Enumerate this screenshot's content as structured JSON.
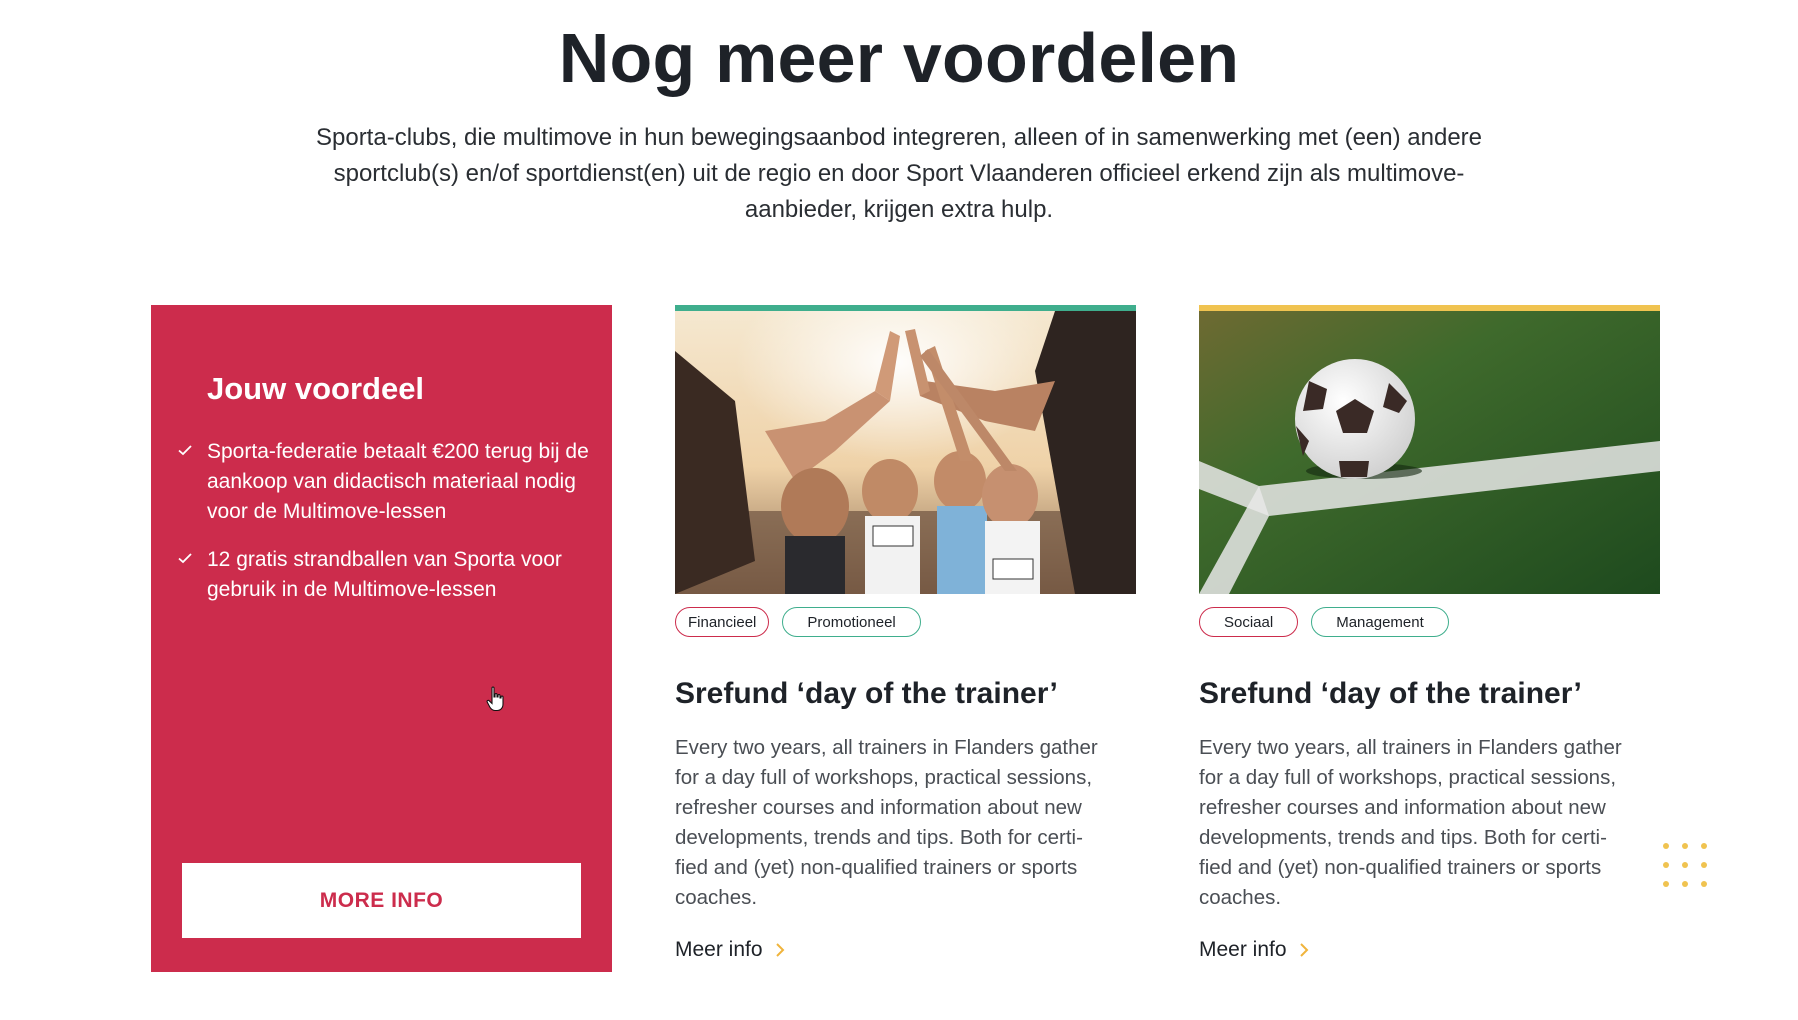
{
  "header": {
    "title": "Nog meer voordelen",
    "intro": "Sporta-clubs, die multimove in hun bewegingsaanbod integreren, alleen of in samenwerking met (een) andere sportclub(s) en/of sportdienst(en) uit de regio en door Sport Vlaanderen officieel erkend zijn als multimove-aanbieder, krijgen extra hulp."
  },
  "promo": {
    "title": "Jouw voordeel",
    "items": [
      "Sporta-federatie betaalt €200 terug bij de aankoop van didactisch materiaal nodig voor de Multimove-lessen",
      "12 gratis strandballen van Sporta voor gebruik in de Multimove-lessen"
    ],
    "button_label": "MORE INFO",
    "background_color": "#cc2c4c"
  },
  "cards": [
    {
      "accent_color": "#3fae8d",
      "image": "athletes-high-five-photo",
      "tags": [
        "Financieel",
        "Promotioneel"
      ],
      "title": "Srefund ‘day of the trainer’",
      "description": "Every two years, all trainers in Flanders gather for a day full of workshops, practical sessions, refresher courses and information about new developments, trends and tips. Both for certi-fied and (yet) non-qualified trainers or sports coaches.",
      "link_label": "Meer info"
    },
    {
      "accent_color": "#f0c350",
      "image": "soccer-ball-on-grass-photo",
      "tags": [
        "Sociaal",
        "Management"
      ],
      "title": "Srefund ‘day of the trainer’",
      "description": "Every two years, all trainers in Flanders gather for a day full of workshops, practical sessions, refresher courses and information about new developments, trends and tips. Both for certi-fied and (yet) non-qualified trainers or sports coaches.",
      "link_label": "Meer info"
    }
  ],
  "colors": {
    "tag_red": "#cc2c4c",
    "tag_green": "#3fae8d",
    "link_chevron": "#f0b43c",
    "dots": "#f0c350"
  }
}
